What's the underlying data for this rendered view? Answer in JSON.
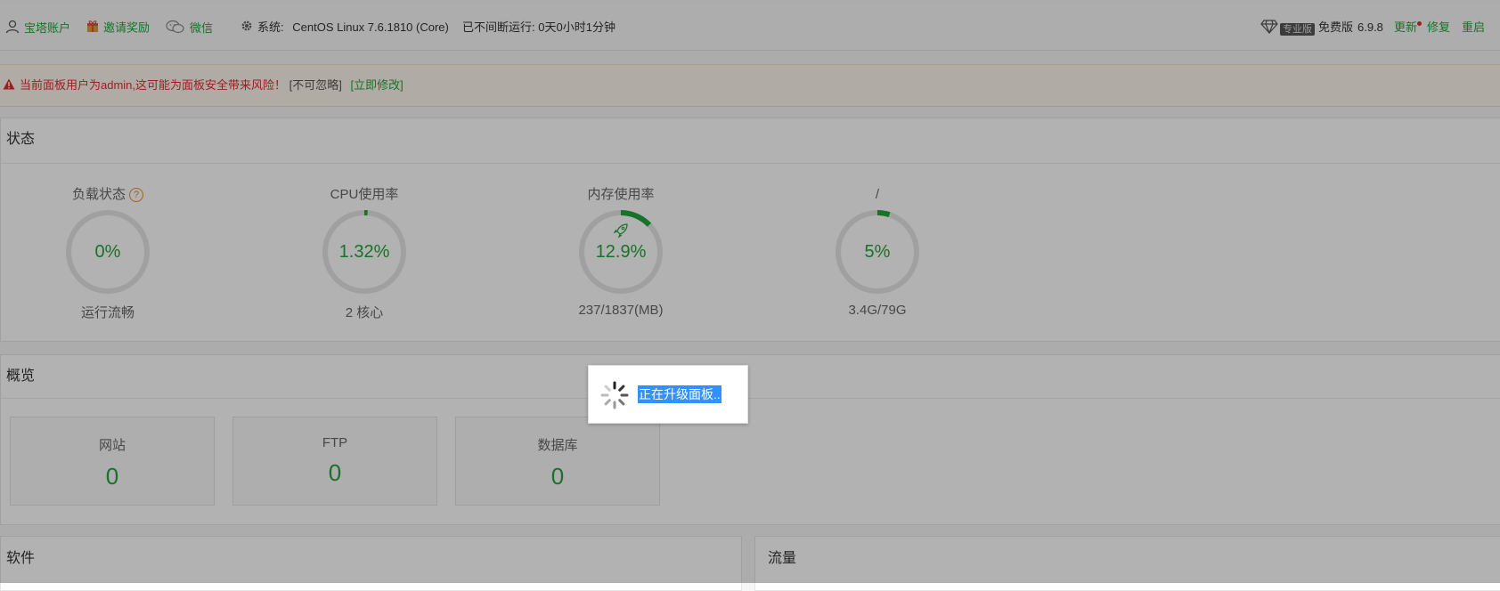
{
  "topbar": {
    "account": "宝塔账户",
    "invite": "邀请奖励",
    "wechat": "微信",
    "system_label": "系统:",
    "system_value": "CentOS Linux 7.6.1810 (Core)",
    "uptime_label": "已不间断运行:",
    "uptime_value": "0天0小时1分钟",
    "pro_badge": "专业版",
    "edition": "免费版",
    "version": "6.9.8",
    "update": "更新",
    "repair": "修复",
    "restart": "重启"
  },
  "warning": {
    "message": "当前面板用户为admin,这可能为面板安全带来风险！",
    "ignore": "[不可忽略]",
    "fix": "[立即修改]"
  },
  "status": {
    "title": "状态",
    "gauges": [
      {
        "label": "负载状态",
        "value": "0%",
        "percent": 0,
        "sub": "运行流畅"
      },
      {
        "label": "CPU使用率",
        "value": "1.32%",
        "percent": 1.32,
        "sub": "2 核心"
      },
      {
        "label": "内存使用率",
        "value": "12.9%",
        "percent": 12.9,
        "sub": "237/1837(MB)"
      },
      {
        "label": "/",
        "value": "5%",
        "percent": 5,
        "sub": "3.4G/79G"
      }
    ]
  },
  "overview": {
    "title": "概览",
    "cards": [
      {
        "label": "网站",
        "value": "0"
      },
      {
        "label": "FTP",
        "value": "0"
      },
      {
        "label": "数据库",
        "value": "0"
      }
    ]
  },
  "software": {
    "title": "软件"
  },
  "traffic": {
    "title": "流量"
  },
  "loading": {
    "text": "正在升级面板.."
  },
  "colors": {
    "accent": "#20a53a",
    "danger": "#e12b2b",
    "selection": "#3390ff",
    "ring_track": "#e6e6e6"
  }
}
